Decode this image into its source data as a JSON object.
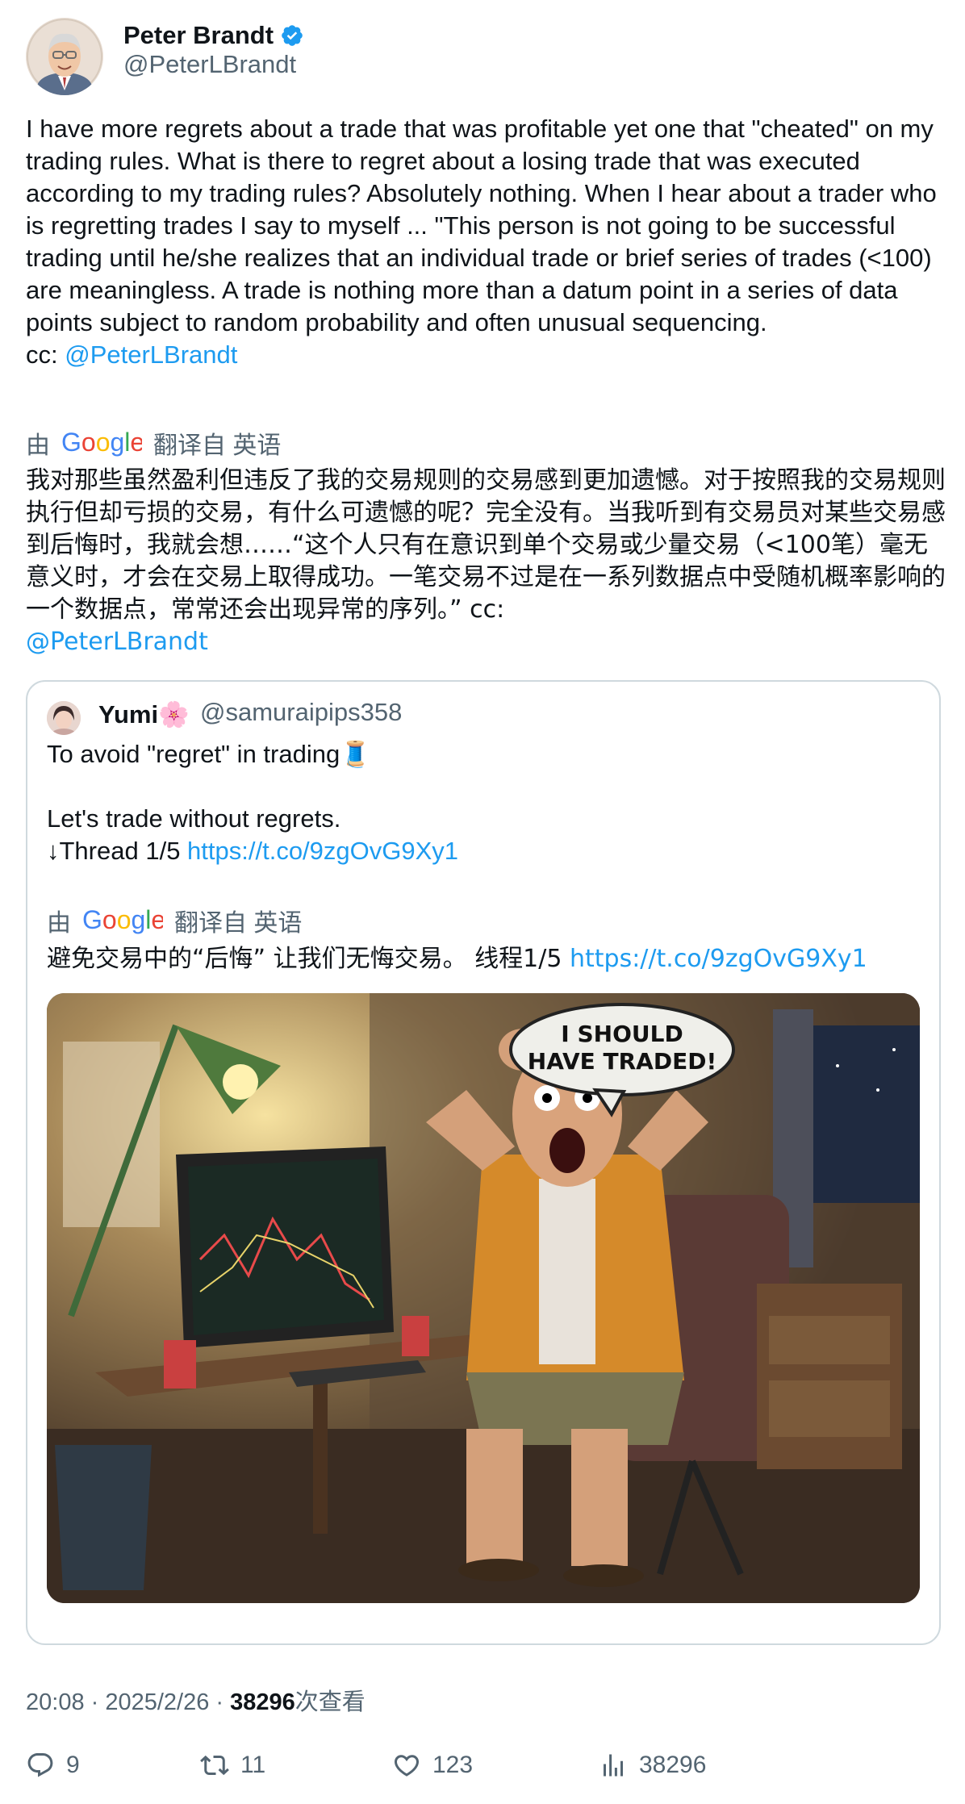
{
  "author": {
    "name": "Peter Brandt",
    "handle": "@PeterLBrandt"
  },
  "tweet": {
    "text": "I have more regrets about a trade that was profitable yet one that \"cheated\" on my trading rules. What is there to regret about a losing trade that was executed according to my trading rules? Absolutely nothing. When I hear about a trader who is regretting trades I say to myself ... \"This person is not going to be successful trading until he/she realizes that an individual trade or brief series of trades (<100) are meaningless. A trade is nothing more than a datum point in a series of data points subject to random probability and often unusual sequencing.",
    "cc_prefix": "cc: ",
    "cc_mention": "@PeterLBrandt"
  },
  "translation": {
    "by": "由",
    "google": "Google",
    "from": "翻译自 英语",
    "text": "我对那些虽然盈利但违反了我的交易规则的交易感到更加遗憾。对于按照我的交易规则执行但却亏损的交易，有什么可遗憾的呢？完全没有。当我听到有交易员对某些交易感到后悔时，我就会想……“这个人只有在意识到单个交易或少量交易（<100笔）毫无意义时，才会在交易上取得成功。一笔交易不过是在一系列数据点中受随机概率影响的一个数据点，常常还会出现异常的序列。” cc:",
    "mention": "@PeterLBrandt"
  },
  "quote": {
    "name": "Yumi🌸",
    "handle": "@samuraipips358",
    "line1": "To avoid \"regret\" in trading🧵",
    "line2": "Let's trade without regrets.",
    "line3_prefix": "↓Thread 1/5 ",
    "link": "https://t.co/9zgOvG9Xy1",
    "translation": {
      "by": "由",
      "google": "Google",
      "from": "翻译自 英语",
      "text": "避免交易中的“后悔” 让我们无悔交易。 线程1/5 ",
      "link": "https://t.co/9zgOvG9Xy1"
    },
    "image": {
      "speech_line1": "I SHOULD",
      "speech_line2": "HAVE TRADED!"
    }
  },
  "meta": {
    "time": "20:08 · 2025/2/26 · ",
    "views_count": "38296",
    "views_label": "次查看"
  },
  "actions": {
    "replies": "9",
    "reposts": "11",
    "likes": "123",
    "views": "38296"
  },
  "colors": {
    "link": "#1d9bf0",
    "secondary": "#536471",
    "verified": "#1d9bf0"
  }
}
